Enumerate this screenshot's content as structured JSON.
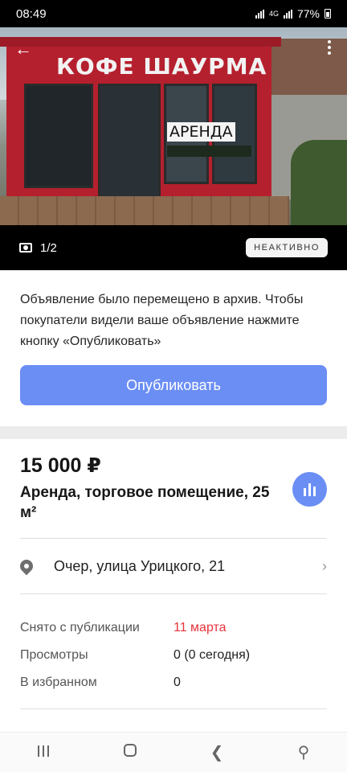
{
  "status_bar": {
    "time": "08:49",
    "battery": "77%",
    "network": "4G"
  },
  "photo": {
    "sign_text": "КОФЕ ШАУРМА",
    "rent_sign": "АРЕНДА",
    "counter": "1/2",
    "status_badge": "НЕАКТИВНО"
  },
  "notice": {
    "text": "Объявление было перемещено в архив. Чтобы покупатели видели ваше объявление нажмите кнопку «Опубликовать»",
    "publish_label": "Опубликовать"
  },
  "listing": {
    "price": "15 000 ₽",
    "title": "Аренда, торговое помещение, 25 м²",
    "address": "Очер, улица Урицкого, 21"
  },
  "info": [
    {
      "label": "Снято с публикации",
      "value": "11 марта"
    },
    {
      "label": "Просмотры",
      "value": "0 (0 сегодня)"
    },
    {
      "label": "В избранном",
      "value": "0"
    }
  ],
  "colors": {
    "accent": "#6b8ef5",
    "unpublished_date": "#e5343c"
  }
}
